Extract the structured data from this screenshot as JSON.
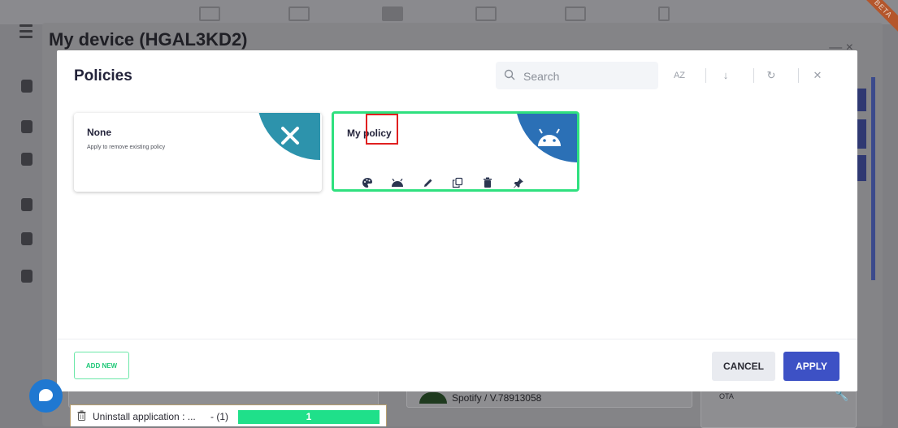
{
  "background": {
    "device_title": "My device (HGAL3KD2)",
    "window_controls": "—   ×",
    "beta_label": "BETA",
    "spotify_label": "Spotify / V.78913058",
    "ota_label": "OTA"
  },
  "modal": {
    "title": "Policies",
    "search_placeholder": "Search",
    "toolbar": {
      "sort_alpha": "AZ",
      "sort_direction": "↓",
      "refresh": "↻",
      "close": "✕"
    },
    "cards": [
      {
        "title": "None",
        "subtitle": "Apply to remove existing policy",
        "badge_icon": "close-icon",
        "selected": false
      },
      {
        "title": "My policy",
        "subtitle": "",
        "badge_icon": "android-icon",
        "selected": true,
        "actions": [
          "palette-icon",
          "android-icon",
          "pencil-icon",
          "copy-icon",
          "trash-icon",
          "pin-icon"
        ]
      }
    ],
    "add_new_label": "ADD NEW",
    "cancel_label": "CANCEL",
    "apply_label": "APPLY"
  },
  "task_bar": {
    "label": "Uninstall application : ...",
    "count": "- (1)",
    "progress_text": "1",
    "progress_fraction": 1.0
  },
  "colors": {
    "accent_green": "#2fe07f",
    "apply_blue": "#3d51c5",
    "none_badge": "#2d93ac",
    "policy_badge": "#2b70b6",
    "highlight_red": "#e02020"
  }
}
